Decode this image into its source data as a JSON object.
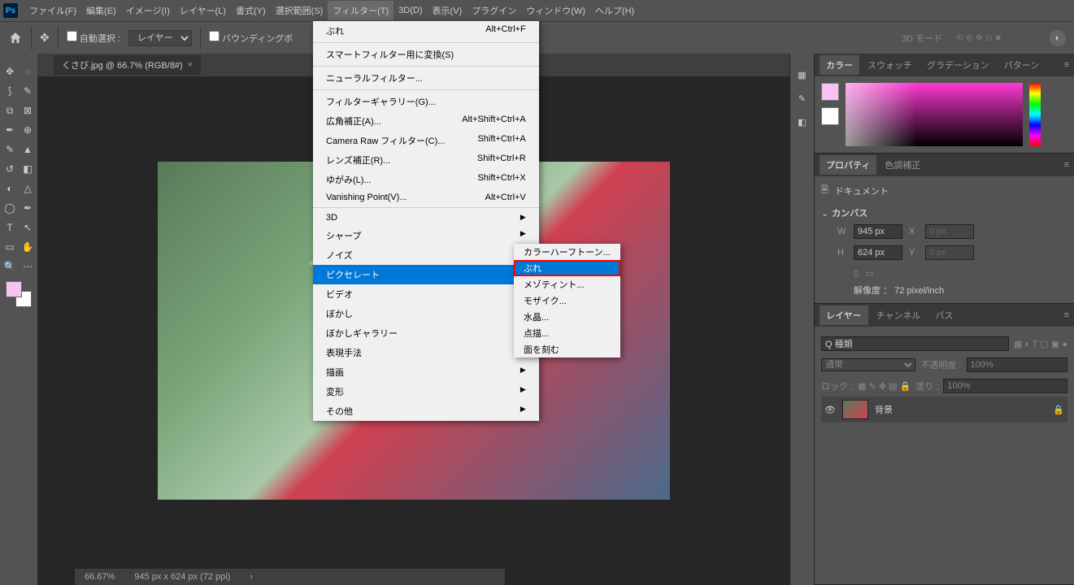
{
  "menubar": {
    "items": [
      "ファイル(F)",
      "編集(E)",
      "イメージ(I)",
      "レイヤー(L)",
      "書式(Y)",
      "選択範囲(S)",
      "フィルター(T)",
      "3D(D)",
      "表示(V)",
      "プラグイン",
      "ウィンドウ(W)",
      "ヘルプ(H)"
    ],
    "active_index": 6
  },
  "optbar": {
    "auto_select": "自動選択 :",
    "select_target": "レイヤー",
    "bounding": "バウンディングボ",
    "mode3d": "3D モード :"
  },
  "doctab": {
    "label": "くさび.jpg @ 66.7% (RGB/8#)"
  },
  "filter_menu": {
    "last": {
      "label": "ぶれ",
      "shortcut": "Alt+Ctrl+F"
    },
    "convert_smart": "スマートフィルター用に変換(S)",
    "neural": "ニューラルフィルター...",
    "gallery": "フィルターギャラリー(G)...",
    "wide_angle": {
      "label": "広角補正(A)...",
      "shortcut": "Alt+Shift+Ctrl+A"
    },
    "camera_raw": {
      "label": "Camera Raw フィルター(C)...",
      "shortcut": "Shift+Ctrl+A"
    },
    "lens": {
      "label": "レンズ補正(R)...",
      "shortcut": "Shift+Ctrl+R"
    },
    "liquify": {
      "label": "ゆがみ(L)...",
      "shortcut": "Shift+Ctrl+X"
    },
    "vanishing": {
      "label": "Vanishing Point(V)...",
      "shortcut": "Alt+Ctrl+V"
    },
    "cat_3d": "3D",
    "cat_sharpen": "シャープ",
    "cat_noise": "ノイズ",
    "cat_pixelate": "ピクセレート",
    "cat_video": "ビデオ",
    "cat_blur": "ぼかし",
    "cat_blur_g": "ぼかしギャラリー",
    "cat_render": "表現手法",
    "cat_artistic": "描画",
    "cat_distort": "変形",
    "cat_other": "その他"
  },
  "pixelate_submenu": {
    "color_halftone": "カラーハーフトーン...",
    "bure": "ぶれ",
    "mezzotint": "メゾティント...",
    "mosaic": "モザイク...",
    "crystal": "水晶...",
    "pointillize": "点描...",
    "facet": "面を刻む"
  },
  "panels": {
    "color_tabs": [
      "カラー",
      "スウォッチ",
      "グラデーション",
      "パターン"
    ],
    "prop_tabs": [
      "プロパティ",
      "色調補正"
    ],
    "doc_label": "ドキュメント",
    "canvas_label": "カンバス",
    "w_label": "W",
    "w_value": "945 px",
    "h_label": "H",
    "h_value": "624 px",
    "x_label": "X",
    "x_value": "0 px",
    "y_label": "Y",
    "y_value": "0 px",
    "resolution": "解像度 ： 72 pixel/inch",
    "layer_tabs": [
      "レイヤー",
      "チャンネル",
      "パス"
    ],
    "layer_filter": "Q 種類",
    "blend_mode": "通常",
    "opacity_label": "不透明度 :",
    "opacity_value": "100%",
    "lock_label": "ロック :",
    "fill_label": "塗り :",
    "fill_value": "100%",
    "bg_layer": "背景"
  },
  "status": {
    "zoom": "66.67%",
    "dims": "945 px x 624 px (72 ppi)"
  }
}
